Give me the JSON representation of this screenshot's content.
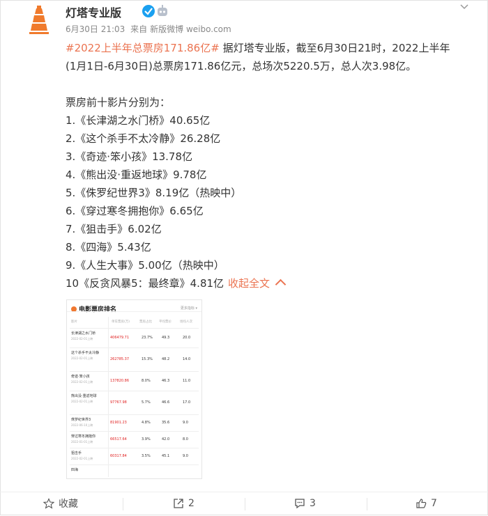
{
  "post": {
    "username": "灯塔专业版",
    "time": "6月30日 21:03",
    "source_prefix": "来自",
    "source": "新版微博 weibo.com",
    "hashtag": "#2022上半年总票房171.86亿#",
    "line1": " 据灯塔专业版，截至6月30日21时，2022上半年",
    "line2": "(1月1日-6月30日)总票房171.86亿元，总场次5220.5万，总人次3.98亿。",
    "list_header": "票房前十影片分别为：",
    "items": [
      "1.《长津湖之水门桥》40.65亿",
      "2.《这个杀手不太冷静》26.28亿",
      "3.《奇迹·笨小孩》13.78亿",
      "4.《熊出没·重返地球》9.78亿",
      "5.《侏罗纪世界3》8.19亿（热映中）",
      "6.《穿过寒冬拥抱你》6.65亿",
      "7.《狙击手》6.02亿",
      "8.《四海》5.43亿",
      "9.《人生大事》5.00亿（热映中）",
      "10《反贪风暴5：最终章》4.81亿"
    ],
    "collapse_label": "收起全文"
  },
  "image": {
    "title": "电影票房排名",
    "more": "更多指标 ▾",
    "headers": [
      "影片",
      "单车票房(万)",
      "票房占比",
      "平均票价",
      "场均人次"
    ],
    "rows": [
      {
        "name": "长津湖之水门桥",
        "date": "2022-02-01上映",
        "bo": "406479.71",
        "share": "23.7%",
        "price": "49.3",
        "people": "20.0"
      },
      {
        "name": "这个杀手不太冷静",
        "date": "2022-02-01上映",
        "bo": "262785.37",
        "share": "15.3%",
        "price": "48.2",
        "people": "14.0"
      },
      {
        "name": "奇迹·笨小孩",
        "date": "2022-02-01上映",
        "bo": "137820.86",
        "share": "8.0%",
        "price": "46.3",
        "people": "11.0"
      },
      {
        "name": "熊出没·重返地球",
        "date": "2022-02-01上映",
        "bo": "97767.98",
        "share": "5.7%",
        "price": "46.6",
        "people": "17.0"
      },
      {
        "name": "侏罗纪世界3",
        "date": "2022-06-10上映",
        "bo": "81901.23",
        "share": "4.8%",
        "price": "35.6",
        "people": "9.0"
      },
      {
        "name": "穿过寒冬拥抱你",
        "date": "2022-01-01上映",
        "bo": "66517.64",
        "share": "3.9%",
        "price": "42.0",
        "people": "8.0"
      },
      {
        "name": "狙击手",
        "date": "2022-02-01上映",
        "bo": "60317.84",
        "share": "3.5%",
        "price": "45.1",
        "people": "9.0"
      },
      {
        "name": "四海",
        "date": "",
        "bo": "",
        "share": "",
        "price": "",
        "people": ""
      }
    ]
  },
  "actions": {
    "favorite_label": "收藏",
    "repost_count": "2",
    "comment_count": "3",
    "like_count": "7"
  },
  "colors": {
    "accent": "#eb7350",
    "verified": "#ffb400",
    "box_office_red": "#e02020"
  },
  "icons": [
    "lighthouse-avatar-icon",
    "verified-icon",
    "robot-badge-icon",
    "chevron-down-icon",
    "star-icon",
    "repost-icon",
    "comment-icon",
    "like-icon"
  ]
}
